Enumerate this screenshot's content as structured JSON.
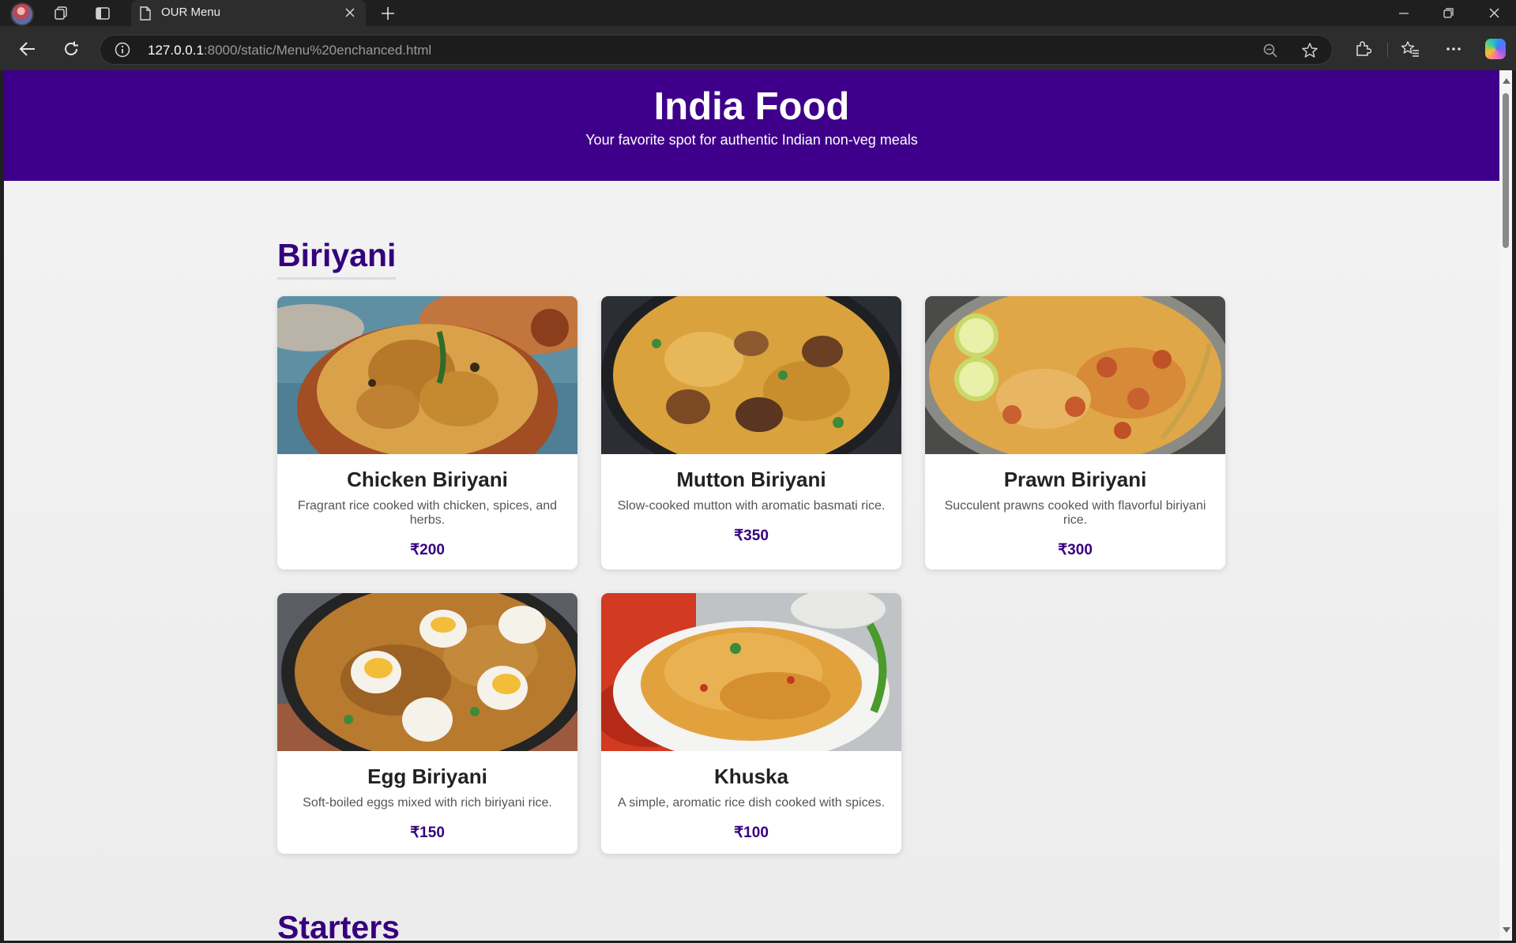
{
  "browser": {
    "tab_title": "OUR Menu",
    "url_host": "127.0.0.1",
    "url_rest": ":8000/static/Menu%20enchanced.html"
  },
  "header": {
    "title": "India Food",
    "tagline": "Your favorite spot for authentic Indian non-veg meals"
  },
  "sections": [
    {
      "title": "Biriyani",
      "items": [
        {
          "name": "Chicken Biriyani",
          "desc": "Fragrant rice cooked with chicken, spices, and herbs.",
          "price": "₹200"
        },
        {
          "name": "Mutton Biriyani",
          "desc": "Slow-cooked mutton with aromatic basmati rice.",
          "price": "₹350"
        },
        {
          "name": "Prawn Biriyani",
          "desc": "Succulent prawns cooked with flavorful biriyani rice.",
          "price": "₹300"
        },
        {
          "name": "Egg Biriyani",
          "desc": "Soft-boiled eggs mixed with rich biriyani rice.",
          "price": "₹150"
        },
        {
          "name": "Khuska",
          "desc": "A simple, aromatic rice dish cooked with spices.",
          "price": "₹100"
        }
      ]
    },
    {
      "title": "Starters"
    }
  ],
  "colors": {
    "header_bg": "#3e008a",
    "accent": "#36007d"
  }
}
